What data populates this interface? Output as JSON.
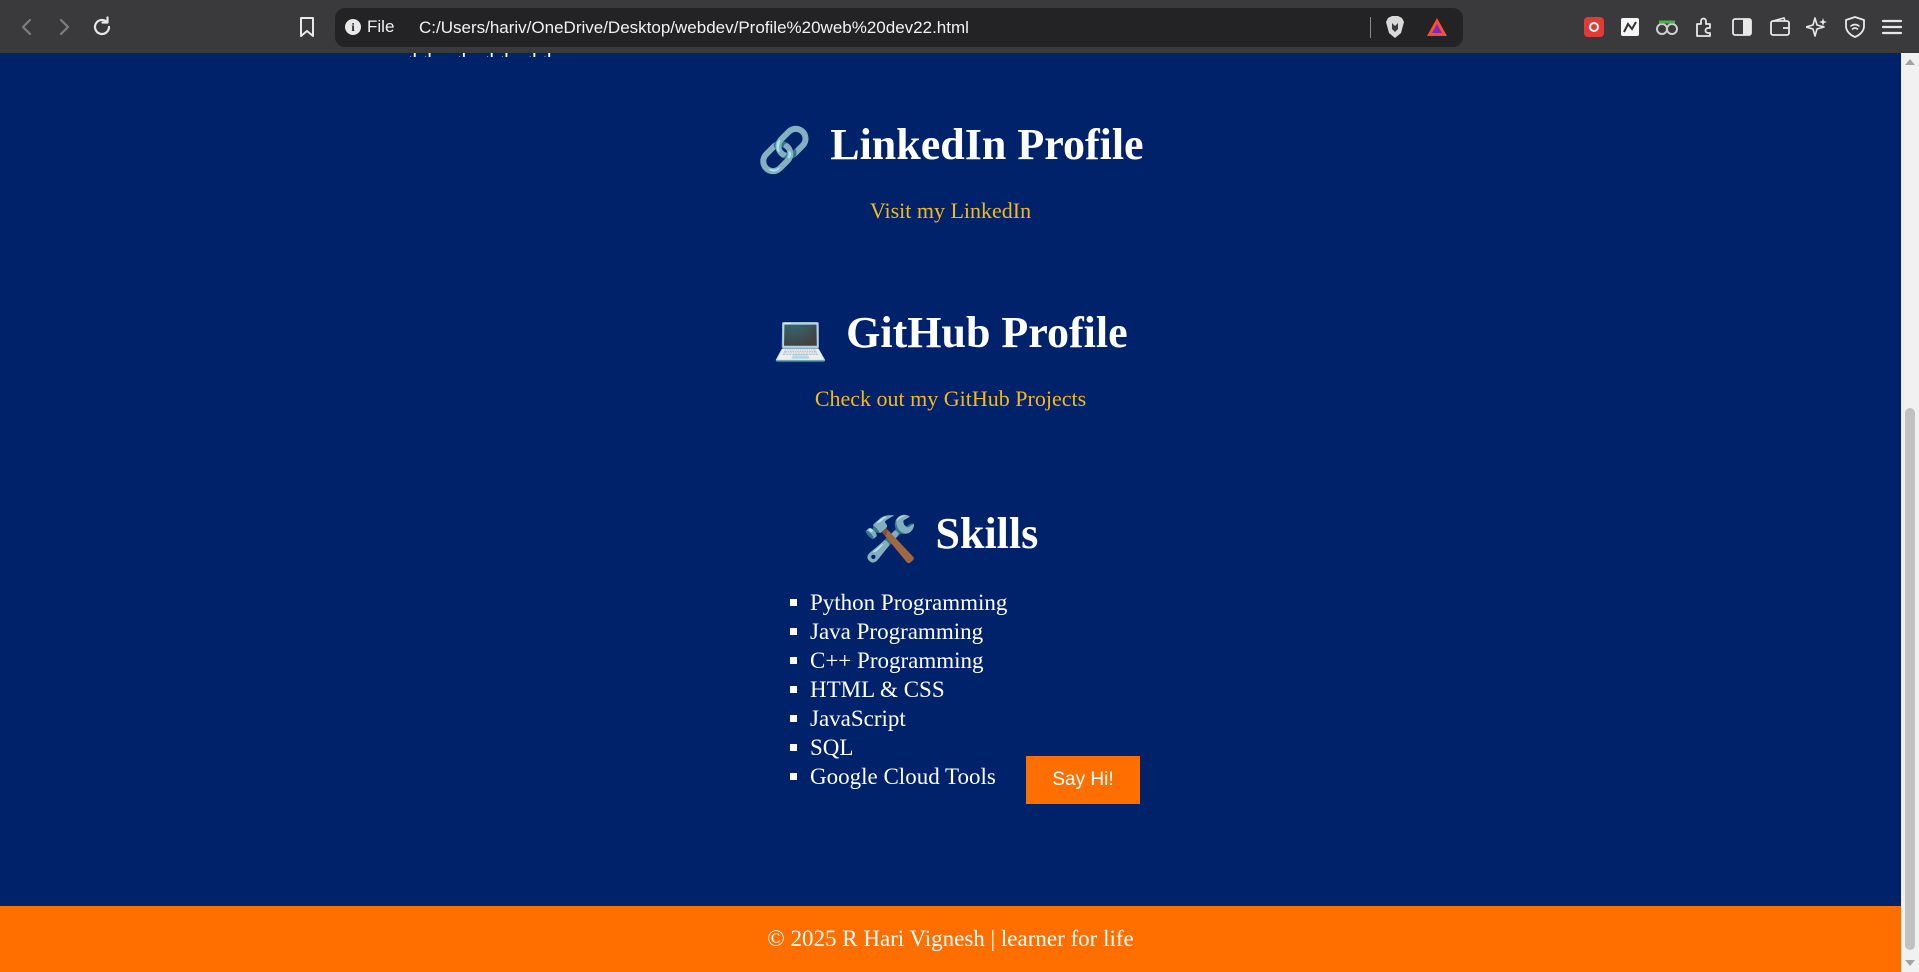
{
  "browser": {
    "site_info_label": "File",
    "url": "C:/Users/hariv/OneDrive/Desktop/webdev/Profile%20web%20dev22.html",
    "icons": [
      "back-icon",
      "forward-icon",
      "reload-icon",
      "bookmark-icon",
      "site-info-icon",
      "brave-shields-icon",
      "brave-rewards-icon",
      "extension-icon",
      "sidebar-icon",
      "wallet-icon",
      "leo-ai-icon",
      "vpn-icon",
      "menu-icon"
    ]
  },
  "page": {
    "linkedin": {
      "emoji": "🔗",
      "heading": "LinkedIn Profile",
      "link_text": "Visit my LinkedIn"
    },
    "github": {
      "emoji": "💻",
      "heading": "GitHub Profile",
      "link_text": "Check out my GitHub Projects"
    },
    "skills": {
      "emoji": "🛠️",
      "heading": "Skills",
      "items": [
        "Python Programming",
        "Java Programming",
        "C++ Programming",
        "HTML & CSS",
        "JavaScript",
        "SQL",
        "Google Cloud Tools"
      ],
      "button_label": "Say Hi!"
    },
    "footer_text": "© 2025 R Hari Vignesh | learner for life"
  },
  "colors": {
    "page_background": "#00226b",
    "link": "#f5b81e",
    "accent": "#ff6f00",
    "browser_toolbar": "#3a3a3c"
  }
}
